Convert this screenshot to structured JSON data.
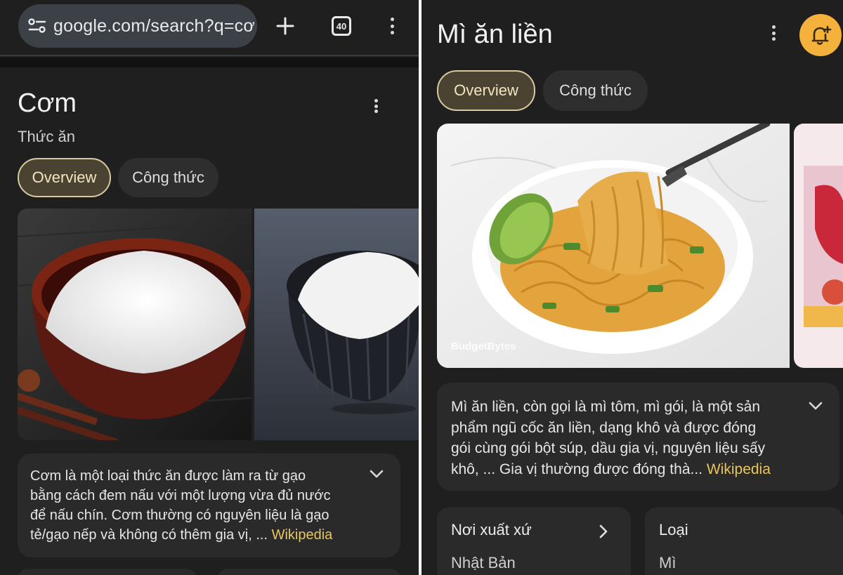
{
  "browser": {
    "url": "google.com/search?q=cơ",
    "tab_count": "40"
  },
  "left_panel": {
    "title": "Cơm",
    "subtitle": "Thức ăn",
    "chips": [
      {
        "label": "Overview",
        "active": true
      },
      {
        "label": "Công thức",
        "active": false
      }
    ],
    "description": {
      "lines": [
        "Cơm là một loại thức ăn được làm ra từ gạo",
        "bằng cách đem nấu với một lượng vừa đủ nước",
        "để nấu chín. Cơm thường có nguyên liệu là gạo",
        "tẻ/gạo nếp và không có thêm gia vị, ..."
      ],
      "source": "Wikipedia"
    }
  },
  "right_panel": {
    "title": "Mì ăn liền",
    "chips": [
      {
        "label": "Overview",
        "active": true
      },
      {
        "label": "Công thức",
        "active": false
      }
    ],
    "image_watermark": "BudgetBytes",
    "description": {
      "lines": [
        "Mì ăn liền, còn gọi là mì tôm, mì gói, là một sản",
        "phẩm ngũ cốc ăn liền, dạng khô và được đóng",
        "gói cùng gói bột súp, dầu gia vị, nguyên liệu sấy",
        "khô, ... Gia vị thường được đóng thà..."
      ],
      "source": "Wikipedia"
    },
    "info": [
      {
        "label": "Nơi xuất xứ",
        "value": "Nhật Bản"
      },
      {
        "label": "Loại",
        "value": "Mì"
      }
    ]
  },
  "colors": {
    "background": "#1f1f1f",
    "card": "#2a2a2a",
    "chip_active": "#4a4331",
    "link": "#e7c55f",
    "bell_button": "#f4b23d"
  },
  "icons": [
    "page-info-icon",
    "new-tab-icon",
    "tab-switcher-icon",
    "more-vert-icon",
    "expand-more-icon",
    "chevron-right-icon",
    "add-alert-icon"
  ]
}
